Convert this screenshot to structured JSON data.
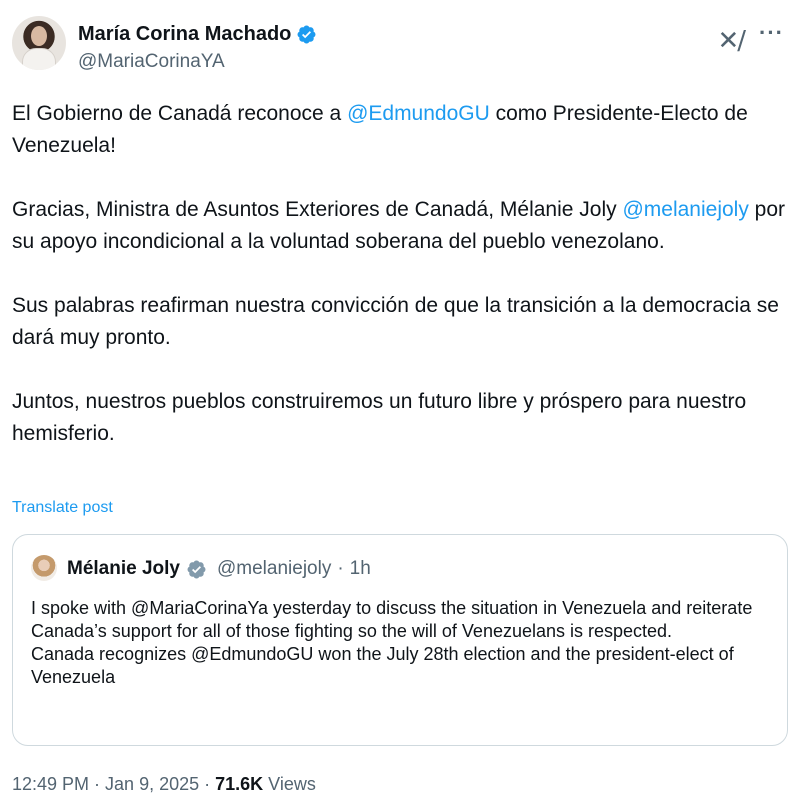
{
  "author": {
    "display_name": "María Corina Machado",
    "handle": "@MariaCorinaYA",
    "verified_color": "#1d9bf0",
    "avatar_icon": "portrait-avatar"
  },
  "header_icons": {
    "logo_icon": "grok-icon",
    "logo_glyph": "✕/",
    "more_icon": "ellipsis-icon",
    "more_glyph": "···"
  },
  "tweet": {
    "p1_part1": "El Gobierno de Canadá reconoce a ",
    "p1_mention": "@EdmundoGU",
    "p1_part2": " como Presidente-Electo de Venezuela!",
    "p2_part1": "Gracias, Ministra de Asuntos Exteriores de Canadá, Mélanie Joly ",
    "p2_mention": "@melaniejoly",
    "p2_part2": " por su apoyo incondicional a la voluntad soberana del pueblo venezolano.",
    "p3": "Sus palabras reafirman nuestra convicción de que la transición a la democracia se dará muy pronto.",
    "p4": "Juntos, nuestros pueblos construiremos un futuro libre y próspero para nuestro hemisferio."
  },
  "translate_label": "Translate post",
  "quote": {
    "display_name": "Mélanie Joly",
    "handle": "@melaniejoly",
    "separator": "·",
    "time": "1h",
    "line1": "I spoke with @MariaCorinaYa yesterday to discuss the situation in Venezuela and reiterate Canada’s support for all of those fighting so the will of Venezuelans is respected.",
    "line2": "Canada recognizes @EdmundoGU won the July 28th election and the president-elect of Venezuela"
  },
  "meta": {
    "time": "12:49 PM",
    "separator": " · ",
    "date": "Jan 9, 2025",
    "views_count": "71.6K",
    "views_label": " Views"
  },
  "colors": {
    "accent": "#1d9bf0",
    "text": "#0f1419",
    "secondary": "#536471",
    "border": "#cfd9de"
  }
}
